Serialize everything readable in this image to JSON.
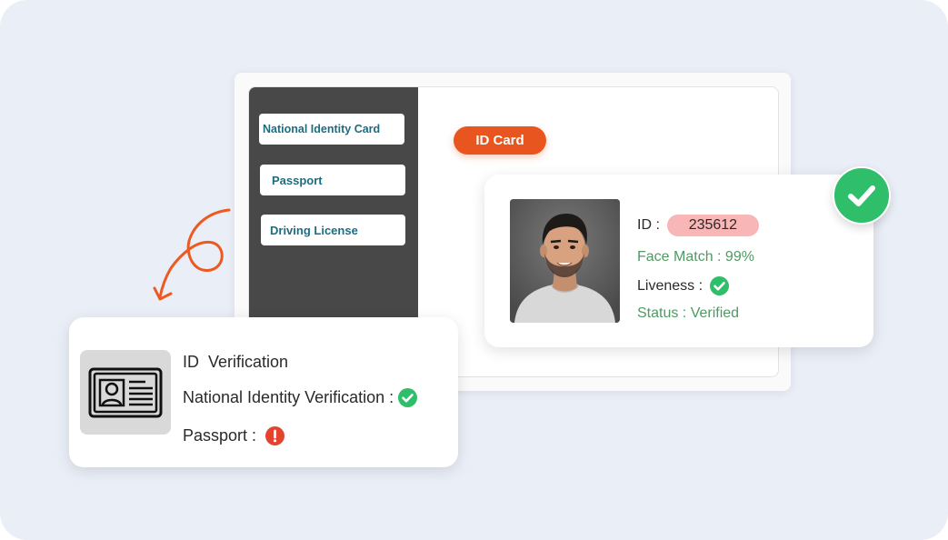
{
  "sidebar": {
    "items": [
      {
        "label": "National Identity Card"
      },
      {
        "label": "Passport"
      },
      {
        "label": "Driving License"
      }
    ]
  },
  "main": {
    "badge_label": "ID Card"
  },
  "profile": {
    "id_label": "ID :",
    "id_value": "235612",
    "face_match": "Face Match : 99%",
    "liveness_label": "Liveness :",
    "status": "Status : Verified"
  },
  "verification": {
    "title": "ID  Verification",
    "national_label": "National Identity Verification :",
    "passport_label": "Passport :"
  },
  "icons": {
    "verified": "check-circle-icon",
    "warning": "exclamation-circle-icon",
    "id_card": "id-card-icon",
    "arrow": "curly-arrow-icon"
  },
  "colors": {
    "background": "#eaeef7",
    "accent_orange": "#e9551f",
    "success_green": "#2fbe6a",
    "text_green": "#4f9a63",
    "sidebar_dark": "#484848",
    "sidebar_text": "#1b6d80",
    "id_badge_pink": "#f8b6b6",
    "warning_red": "#e3432f"
  }
}
